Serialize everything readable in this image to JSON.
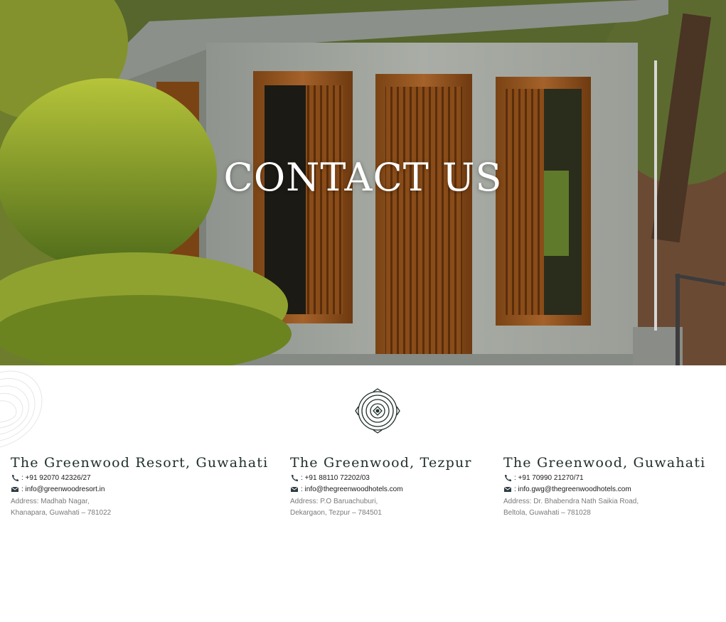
{
  "hero": {
    "title": "CONTACT US"
  },
  "icons": {
    "phone": "phone-icon",
    "email": "envelope-icon",
    "emblem": "resort-emblem-icon"
  },
  "locations": [
    {
      "name": "The Greenwood Resort, Guwahati",
      "phone": ": +91 92070 42326/27",
      "email": ": info@greenwoodresort.in",
      "address_line1": "Address: Madhab Nagar,",
      "address_line2": "Khanapara, Guwahati – 781022"
    },
    {
      "name": "The Greenwood, Tezpur",
      "phone": ": +91 88110 72202/03",
      "email": ": info@thegreenwoodhotels.com",
      "address_line1": "Address: P.O Baruachuburi,",
      "address_line2": "Dekargaon, Tezpur – 784501"
    },
    {
      "name": "The Greenwood, Guwahati",
      "phone": ": +91 70990 21270/71",
      "email": ": info.gwg@thegreenwoodhotels.com",
      "address_line1": "Address: Dr. Bhabendra Nath Saikia Road,",
      "address_line2": "Beltola, Guwahati – 781028"
    }
  ]
}
